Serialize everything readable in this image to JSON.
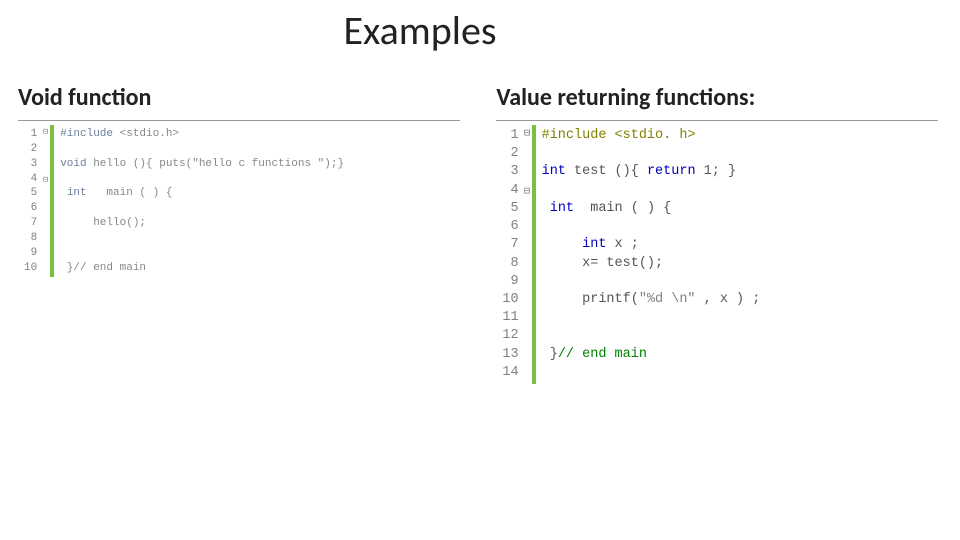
{
  "title": "Examples",
  "left": {
    "heading": "Void function",
    "lines": [
      {
        "n": "1",
        "fold": "⊟",
        "tokens": [
          {
            "c": "fadedkw",
            "t": "#include "
          },
          {
            "c": "faded",
            "t": "<stdio.h>"
          }
        ]
      },
      {
        "n": "2",
        "fold": "",
        "tokens": [
          {
            "c": "faded",
            "t": ""
          }
        ]
      },
      {
        "n": "3",
        "fold": "",
        "tokens": [
          {
            "c": "fadedkw",
            "t": "void"
          },
          {
            "c": "faded",
            "t": " hello (){ puts("
          },
          {
            "c": "faded",
            "t": "\"hello c functions \""
          },
          {
            "c": "faded",
            "t": ");}"
          }
        ]
      },
      {
        "n": "4",
        "fold": "",
        "tokens": [
          {
            "c": "faded",
            "t": ""
          }
        ]
      },
      {
        "n": "5",
        "fold": "⊟",
        "tokens": [
          {
            "c": "faded",
            "t": " "
          },
          {
            "c": "fadedkw",
            "t": "int"
          },
          {
            "c": "faded",
            "t": "   main ( ) {"
          }
        ]
      },
      {
        "n": "6",
        "fold": "",
        "tokens": [
          {
            "c": "faded",
            "t": ""
          }
        ]
      },
      {
        "n": "7",
        "fold": "",
        "tokens": [
          {
            "c": "faded",
            "t": "     hello();"
          }
        ]
      },
      {
        "n": "8",
        "fold": "",
        "tokens": [
          {
            "c": "faded",
            "t": ""
          }
        ]
      },
      {
        "n": "9",
        "fold": "",
        "tokens": [
          {
            "c": "faded",
            "t": ""
          }
        ]
      },
      {
        "n": "10",
        "fold": "",
        "tokens": [
          {
            "c": "faded",
            "t": " }"
          },
          {
            "c": "faded",
            "t": "// end main"
          }
        ]
      }
    ]
  },
  "right": {
    "heading": "Value returning functions:",
    "lines": [
      {
        "n": "1",
        "fold": "⊟",
        "tokens": [
          {
            "c": "pp",
            "t": "#include "
          },
          {
            "c": "sys",
            "t": "<stdio. h>"
          }
        ]
      },
      {
        "n": "2",
        "fold": "",
        "tokens": [
          {
            "c": "plain",
            "t": ""
          }
        ]
      },
      {
        "n": "3",
        "fold": "",
        "tokens": [
          {
            "c": "kw",
            "t": "int"
          },
          {
            "c": "plain",
            "t": " test (){ "
          },
          {
            "c": "kw",
            "t": "return"
          },
          {
            "c": "plain",
            "t": " 1; }"
          }
        ]
      },
      {
        "n": "4",
        "fold": "",
        "tokens": [
          {
            "c": "plain",
            "t": ""
          }
        ]
      },
      {
        "n": "5",
        "fold": "⊟",
        "tokens": [
          {
            "c": "plain",
            "t": " "
          },
          {
            "c": "kw",
            "t": "int"
          },
          {
            "c": "plain",
            "t": "  main ( ) {"
          }
        ]
      },
      {
        "n": "6",
        "fold": "",
        "tokens": [
          {
            "c": "plain",
            "t": ""
          }
        ]
      },
      {
        "n": "7",
        "fold": "",
        "tokens": [
          {
            "c": "plain",
            "t": "     "
          },
          {
            "c": "kw",
            "t": "int"
          },
          {
            "c": "plain",
            "t": " x ;"
          }
        ]
      },
      {
        "n": "8",
        "fold": "",
        "tokens": [
          {
            "c": "plain",
            "t": "     x= test();"
          }
        ]
      },
      {
        "n": "9",
        "fold": "",
        "tokens": [
          {
            "c": "plain",
            "t": ""
          }
        ]
      },
      {
        "n": "10",
        "fold": "",
        "tokens": [
          {
            "c": "plain",
            "t": "     printf("
          },
          {
            "c": "str",
            "t": "\"%d \\n\""
          },
          {
            "c": "plain",
            "t": " , x ) ;"
          }
        ]
      },
      {
        "n": "11",
        "fold": "",
        "tokens": [
          {
            "c": "plain",
            "t": ""
          }
        ]
      },
      {
        "n": "12",
        "fold": "",
        "tokens": [
          {
            "c": "plain",
            "t": ""
          }
        ]
      },
      {
        "n": "13",
        "fold": "",
        "tokens": [
          {
            "c": "plain",
            "t": " }"
          },
          {
            "c": "cmt",
            "t": "// end main"
          }
        ]
      },
      {
        "n": "14",
        "fold": "",
        "tokens": [
          {
            "c": "plain",
            "t": ""
          }
        ]
      }
    ]
  }
}
